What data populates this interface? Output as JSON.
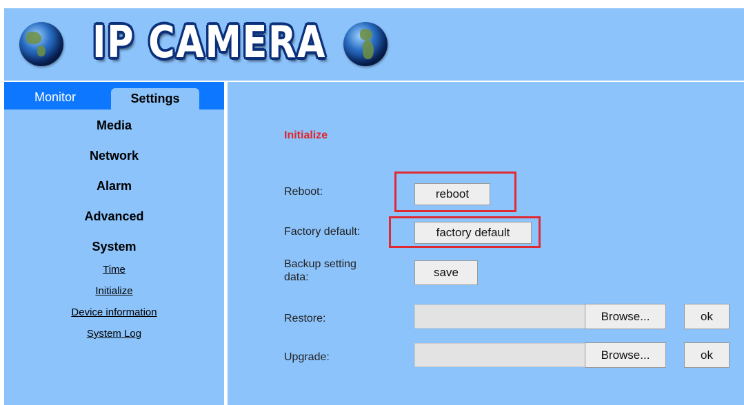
{
  "header": {
    "title": "IP CAMERA"
  },
  "tabs": [
    {
      "label": "Monitor"
    },
    {
      "label": "Settings"
    }
  ],
  "sidebar": {
    "menu": [
      {
        "label": "Media"
      },
      {
        "label": "Network"
      },
      {
        "label": "Alarm"
      },
      {
        "label": "Advanced"
      },
      {
        "label": "System"
      }
    ],
    "submenu": [
      {
        "label": "Time"
      },
      {
        "label": "Initialize"
      },
      {
        "label": "Device information"
      },
      {
        "label": "System Log"
      }
    ]
  },
  "main": {
    "section_title": "Initialize",
    "reboot": {
      "label": "Reboot:",
      "button": "reboot"
    },
    "factory": {
      "label": "Factory default:",
      "button": "factory default"
    },
    "backup": {
      "label": "Backup setting data:",
      "button": "save"
    },
    "restore": {
      "label": "Restore:",
      "browse": "Browse...",
      "ok": "ok"
    },
    "upgrade": {
      "label": "Upgrade:",
      "browse": "Browse...",
      "ok": "ok"
    }
  },
  "colors": {
    "header_bg": "#8cc3fb",
    "tabbar_bg": "#0d78ff",
    "section_title": "#e0262b",
    "highlight_box": "#e02a32"
  }
}
